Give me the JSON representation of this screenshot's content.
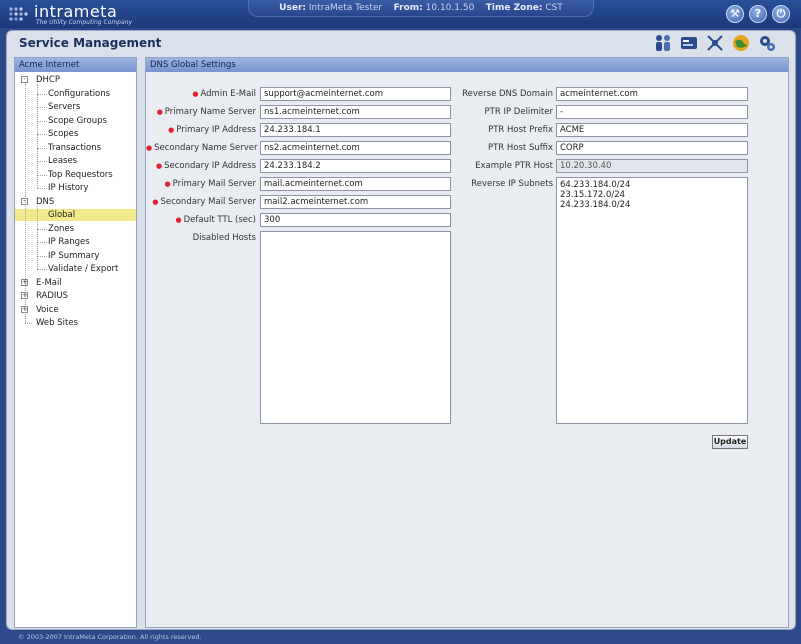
{
  "header": {
    "logo_text": "intrameta",
    "logo_tagline": "The Utility Computing Company",
    "user_label": "User:",
    "user_value": "IntraMeta Tester",
    "from_label": "From:",
    "from_value": "10.10.1.50",
    "tz_label": "Time Zone:",
    "tz_value": "CST",
    "icons": [
      "wrench-icon",
      "help-icon",
      "power-icon"
    ]
  },
  "page": {
    "title": "Service Management",
    "toolbar_icons": [
      "users-icon",
      "card-icon",
      "network-icon",
      "globe-icon",
      "gears-icon"
    ]
  },
  "tree": {
    "header": "Acme Internet",
    "items": [
      {
        "label": "DHCP",
        "level": 0,
        "expander": "-"
      },
      {
        "label": "Configurations",
        "level": 1
      },
      {
        "label": "Servers",
        "level": 1
      },
      {
        "label": "Scope Groups",
        "level": 1
      },
      {
        "label": "Scopes",
        "level": 1
      },
      {
        "label": "Transactions",
        "level": 1
      },
      {
        "label": "Leases",
        "level": 1
      },
      {
        "label": "Top Requestors",
        "level": 1
      },
      {
        "label": "IP History",
        "level": 1
      },
      {
        "label": "DNS",
        "level": 0,
        "expander": "-"
      },
      {
        "label": "Global",
        "level": 1,
        "selected": true
      },
      {
        "label": "Zones",
        "level": 1
      },
      {
        "label": "IP Ranges",
        "level": 1
      },
      {
        "label": "IP Summary",
        "level": 1
      },
      {
        "label": "Validate / Export",
        "level": 1
      },
      {
        "label": "E-Mail",
        "level": 0,
        "expander": "+"
      },
      {
        "label": "RADIUS",
        "level": 0,
        "expander": "+"
      },
      {
        "label": "Voice",
        "level": 0,
        "expander": "+"
      },
      {
        "label": "Web Sites",
        "level": 0
      }
    ]
  },
  "settings": {
    "header": "DNS Global Settings",
    "left_fields": [
      {
        "label": "Admin E-Mail",
        "required": true,
        "value": "support@acmeinternet.com"
      },
      {
        "label": "Primary Name Server",
        "required": true,
        "value": "ns1.acmeinternet.com"
      },
      {
        "label": "Primary IP Address",
        "required": true,
        "value": "24.233.184.1"
      },
      {
        "label": "Secondary Name Server",
        "required": true,
        "value": "ns2.acmeinternet.com"
      },
      {
        "label": "Secondary IP Address",
        "required": true,
        "value": "24.233.184.2"
      },
      {
        "label": "Primary Mail Server",
        "required": true,
        "value": "mail.acmeinternet.com"
      },
      {
        "label": "Secondary Mail Server",
        "required": true,
        "value": "mail2.acmeinternet.com"
      },
      {
        "label": "Default TTL (sec)",
        "required": true,
        "value": "300"
      }
    ],
    "disabled_hosts_label": "Disabled Hosts",
    "disabled_hosts_value": "",
    "right_fields": [
      {
        "label": "Reverse DNS Domain",
        "value": "acmeinternet.com"
      },
      {
        "label": "PTR IP Delimiter",
        "value": "-"
      },
      {
        "label": "PTR Host Prefix",
        "value": "ACME"
      },
      {
        "label": "PTR Host Suffix",
        "value": "CORP"
      },
      {
        "label": "Example PTR Host",
        "value": "10.20.30.40",
        "readonly": true
      }
    ],
    "reverse_subnets_label": "Reverse IP Subnets",
    "reverse_subnets_value": "64.233.184.0/24\n23.15.172.0/24\n24.233.184.0/24",
    "update_label": "Update"
  },
  "footer": {
    "copyright": "© 2003-2007 IntraMeta Corporation.  All rights reserved."
  },
  "colors": {
    "header_bg": "#1b3a7a",
    "selected_bg": "#f2e98a",
    "required_marker": "#dd2233"
  }
}
